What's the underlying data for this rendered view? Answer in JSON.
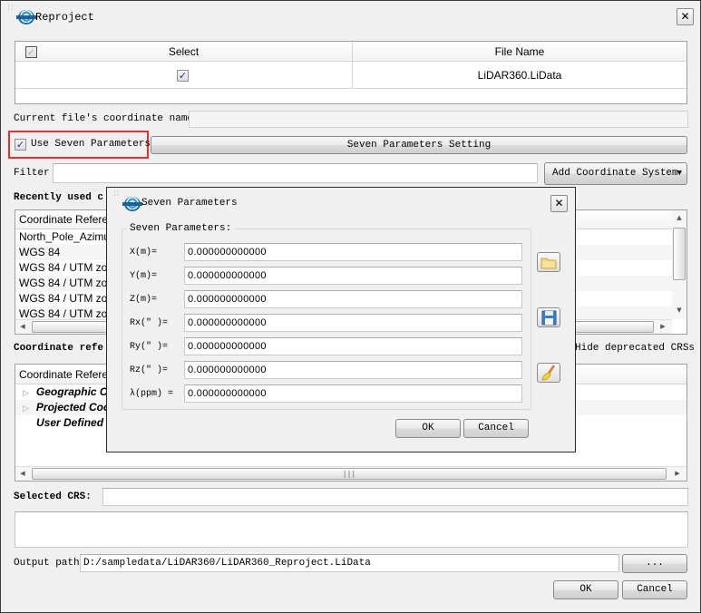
{
  "window": {
    "title": "Reproject",
    "close_icon": "close-icon"
  },
  "files_table": {
    "columns": [
      "Select",
      "File Name"
    ],
    "header_checkbox_checked": true,
    "rows": [
      {
        "selected": true,
        "file_name": "LiDAR360.LiData"
      }
    ]
  },
  "current_coord": {
    "label": "Current file's coordinate name:",
    "value": ""
  },
  "seven_params_toggle": {
    "label": "Use Seven Parameters",
    "checked": true,
    "setting_button": "Seven Parameters Setting",
    "highlight_color": "#e8312f"
  },
  "filter": {
    "label": "Filter",
    "value": "",
    "add_button": "Add Coordinate System"
  },
  "recent": {
    "title": "Recently used c",
    "column": "Coordinate Referen",
    "items": [
      "North_Pole_Azimu",
      "WGS 84",
      "WGS 84 / UTM zon",
      "WGS 84 / UTM zon",
      "WGS 84 / UTM zon",
      "WGS 84 / UTM zon"
    ]
  },
  "crs_tree": {
    "title": "Coordinate refe",
    "hide_deprecated_label": "Hide deprecated CRSs",
    "column": "Coordinate Referen",
    "items": [
      {
        "label": "Geographic Co",
        "expandable": true
      },
      {
        "label": "Projected Coo",
        "expandable": true
      },
      {
        "label": "User Defined C",
        "expandable": false
      }
    ]
  },
  "selected_crs": {
    "label": "Selected CRS:",
    "value": ""
  },
  "output": {
    "label": "Output path:",
    "value": "D:/sampledata/LiDAR360/LiDAR360_Reproject.LiData",
    "browse_button": "..."
  },
  "footer": {
    "ok": "OK",
    "cancel": "Cancel"
  },
  "seven_dialog": {
    "title": "Seven Parameters",
    "group_title": "Seven Parameters:",
    "params": [
      {
        "label": "X(m)=",
        "value": "0.000000000000"
      },
      {
        "label": "Y(m)=",
        "value": "0.000000000000"
      },
      {
        "label": "Z(m)=",
        "value": "0.000000000000"
      },
      {
        "label": "Rx(\" )=",
        "value": "0.000000000000"
      },
      {
        "label": "Ry(\" )=",
        "value": "0.000000000000"
      },
      {
        "label": "Rz(\" )=",
        "value": "0.000000000000"
      },
      {
        "label": "λ(ppm) =",
        "value": "0.000000000000"
      }
    ],
    "side_icons": [
      "open-folder-icon",
      "save-disk-icon",
      "clear-brush-icon"
    ],
    "ok": "OK",
    "cancel": "Cancel"
  }
}
